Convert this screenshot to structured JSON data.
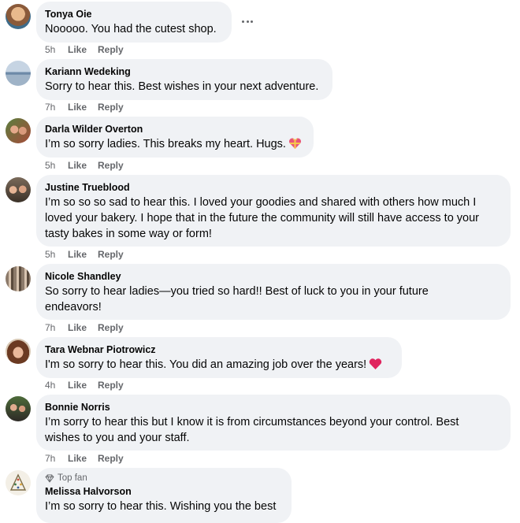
{
  "comments": [
    {
      "author": "Tonya Oie",
      "text": "Nooooo. You had the cutest shop.",
      "time": "5h",
      "like": "Like",
      "reply": "Reply"
    },
    {
      "author": "Kariann Wedeking",
      "text": "Sorry to hear this. Best wishes in your next adventure.",
      "time": "7h",
      "like": "Like",
      "reply": "Reply"
    },
    {
      "author": "Darla Wilder Overton",
      "text": "I’m so sorry ladies. This breaks my heart. Hugs.",
      "time": "5h",
      "like": "Like",
      "reply": "Reply",
      "emoji": "gift-heart-emoji"
    },
    {
      "author": "Justine Trueblood",
      "text_lines": [
        "I’m so so so sad to hear this. I loved your goodies and shared with others how much I",
        "loved your bakery. I hope that in the future the community will still have access to your",
        "tasty bakes in some way or form!"
      ],
      "time": "5h",
      "like": "Like",
      "reply": "Reply"
    },
    {
      "author": "Nicole Shandley",
      "text_lines": [
        "So sorry to hear ladies—you tried so hard!! Best of luck to you in your future",
        "endeavors!"
      ],
      "time": "7h",
      "like": "Like",
      "reply": "Reply"
    },
    {
      "author": "Tara Webnar Piotrowicz",
      "text": "I'm so sorry to hear this. You did an amazing job over the years!",
      "time": "4h",
      "like": "Like",
      "reply": "Reply",
      "emoji": "red-heart-emoji"
    },
    {
      "author": "Bonnie Norris",
      "text_lines": [
        "I’m sorry to hear this but I know it is from circumstances beyond your control. Best",
        "wishes to you and your staff."
      ],
      "time": "7h",
      "like": "Like",
      "reply": "Reply"
    },
    {
      "badge": "Top fan",
      "author": "Melissa Halvorson",
      "text": "I’m so sorry to hear this. Wishing you the best"
    }
  ],
  "colors": {
    "bubble": "#f0f2f5",
    "meta": "#65676b",
    "heart": "#e0245e"
  },
  "icons": {
    "more": "more-options-icon",
    "top_fan": "diamond-badge-icon"
  }
}
